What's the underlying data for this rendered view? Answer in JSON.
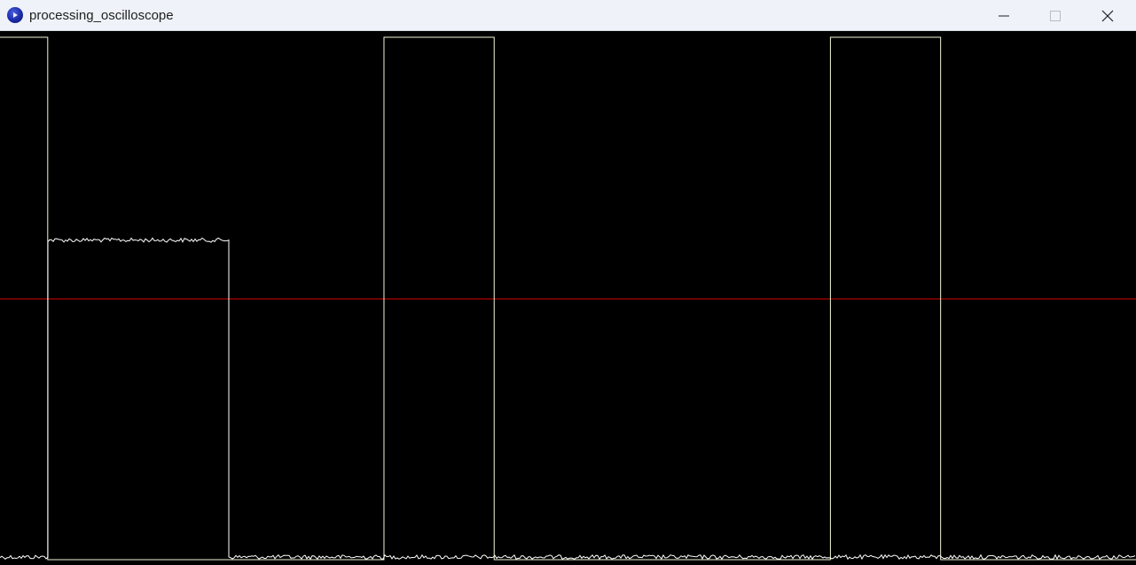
{
  "window": {
    "title": "processing_oscilloscope",
    "icons": {
      "app": "processing-app-icon",
      "minimize": "minimize-icon",
      "maximize": "maximize-icon",
      "close": "close-icon"
    }
  },
  "colors": {
    "titlebar_bg": "#eff2f8",
    "canvas_bg": "#000000",
    "trace": "#ffffff",
    "square_wave": "#f2f5d6",
    "trigger_line": "#e00000"
  },
  "scope": {
    "trigger_level": 0.5,
    "signal_trace": {
      "segments": [
        {
          "from": 0.0,
          "to": 0.041,
          "level": 0.0
        },
        {
          "from": 0.041,
          "to": 0.2,
          "level": 0.61
        },
        {
          "from": 0.2,
          "to": 1.0,
          "level": 0.0
        }
      ],
      "noise_amplitude": 0.004
    },
    "square_wave": {
      "high_level": 1.0,
      "low_level": 0.0,
      "edges": [
        0.0,
        0.042,
        0.338,
        0.435,
        0.731,
        0.828
      ],
      "start_high": true
    }
  }
}
